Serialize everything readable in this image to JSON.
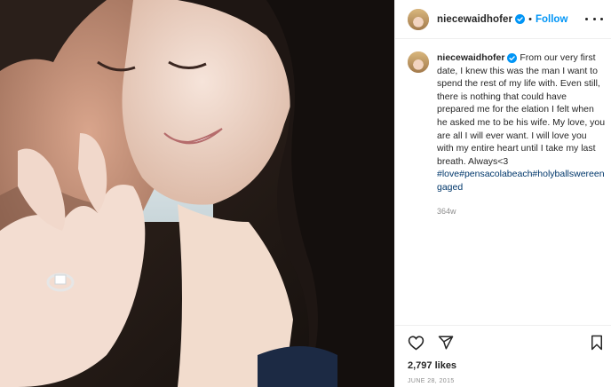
{
  "header": {
    "username": "niecewaidhofer",
    "separator": "•",
    "follow_label": "Follow"
  },
  "caption": {
    "username": "niecewaidhofer",
    "text": " From our very first date, I knew this was the man I want to spend the rest of my life with. Even still, there is nothing that could have prepared me for the elation I felt when he asked me to be his wife. My love, you are all I will ever want. I will love you with my entire heart until I take my last breath. Always<3 ",
    "hashtags": "#love#pensacolabeach#holyballswereengaged",
    "time_ago": "364w"
  },
  "actions": {
    "like_icon": "heart-icon",
    "share_icon": "paper-plane-icon",
    "save_icon": "bookmark-icon"
  },
  "likes_label": "2,797 likes",
  "date_label": "JUNE 28, 2015",
  "colors": {
    "link_blue": "#0095f6",
    "hashtag": "#00376b",
    "muted": "#8e8e8e"
  }
}
